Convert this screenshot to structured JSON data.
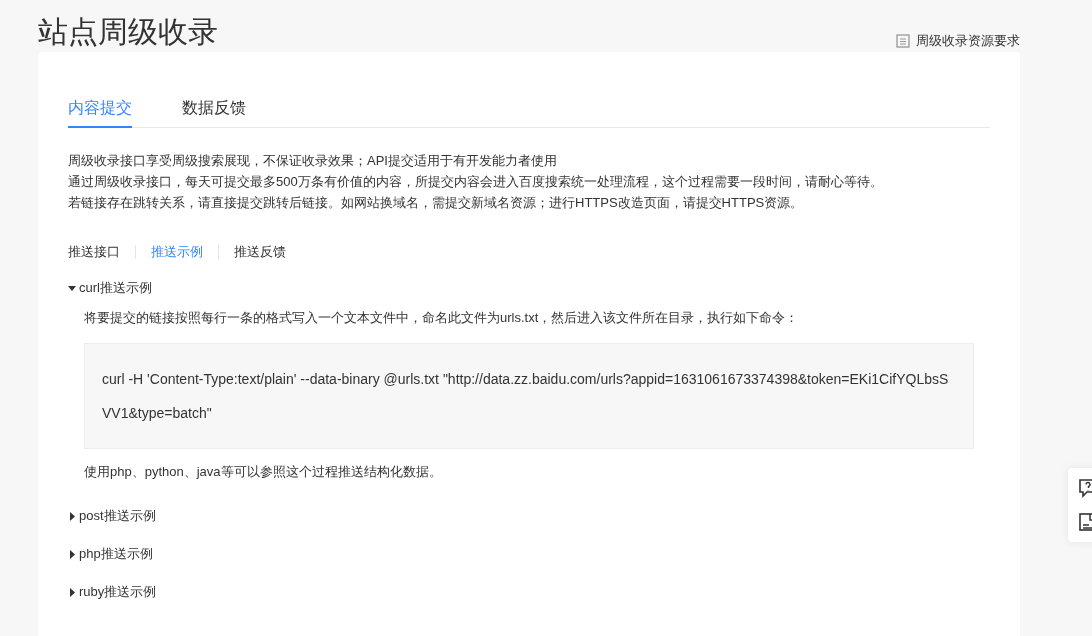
{
  "page_title": "站点周级收录",
  "requirements_link": "周级收录资源要求",
  "tabs": [
    {
      "label": "内容提交",
      "selected": true
    },
    {
      "label": "数据反馈",
      "selected": false
    }
  ],
  "intro_lines": [
    "周级收录接口享受周级搜索展现，不保证收录效果；API提交适用于有开发能力者使用",
    "通过周级收录接口，每天可提交最多500万条有价值的内容，所提交内容会进入百度搜索统一处理流程，这个过程需要一段时间，请耐心等待。",
    "若链接存在跳转关系，请直接提交跳转后链接。如网站换域名，需提交新域名资源；进行HTTPS改造页面，请提交HTTPS资源。"
  ],
  "sub_tabs": [
    {
      "label": "推送接口",
      "selected": false
    },
    {
      "label": "推送示例",
      "selected": true
    },
    {
      "label": "推送反馈",
      "selected": false
    }
  ],
  "sections": [
    {
      "title": "curl推送示例",
      "expanded": true,
      "instruction": "将要提交的链接按照每行一条的格式写入一个文本文件中，命名此文件为urls.txt，然后进入该文件所在目录，执行如下命令：",
      "code": "curl -H 'Content-Type:text/plain' --data-binary @urls.txt \"http://data.zz.baidu.com/urls?appid=1631061673374398&token=EKi1CifYQLbsSVV1&type=batch\"",
      "note": "使用php、python、java等可以参照这个过程推送结构化数据。"
    },
    {
      "title": "post推送示例",
      "expanded": false
    },
    {
      "title": "php推送示例",
      "expanded": false
    },
    {
      "title": "ruby推送示例",
      "expanded": false
    }
  ]
}
